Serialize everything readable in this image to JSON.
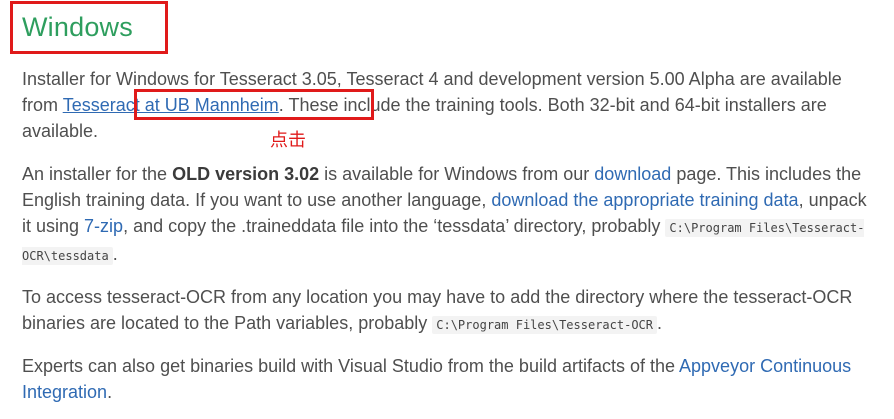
{
  "section": {
    "heading": "Windows"
  },
  "annotation": {
    "click_label": "点击"
  },
  "paragraph1": {
    "text_a": "Installer for Windows for Tesseract 3.05, Tesseract 4 and development version 5.00 Alpha are available from ",
    "link_mannheim": "Tesseract at UB Mannheim",
    "text_b": ". These include the training tools. Both 32-bit and 64-bit installers are available."
  },
  "paragraph2": {
    "text_a": "An installer for the ",
    "bold_version": "OLD version 3.02",
    "text_b": " is available for Windows from our ",
    "link_download": "download",
    "text_c": " page. This includes the English training data. If you want to use another language, ",
    "link_training_data": "download the appropriate training data",
    "text_d": ", unpack it using ",
    "link_7zip": "7-zip",
    "text_e": ", and copy the .traineddata file into the ‘tessdata’ directory, probably ",
    "code_path": "C:\\Program Files\\Tesseract-OCR\\tessdata",
    "text_f": "."
  },
  "paragraph3": {
    "text_a": "To access tesseract-OCR from any location you may have to add the directory where the tesseract-OCR binaries are located to the Path variables, probably ",
    "code_path": "C:\\Program Files\\Tesseract-OCR",
    "text_b": "."
  },
  "paragraph4": {
    "text_a": "Experts can also get binaries build with Visual Studio from the build artifacts of the ",
    "link_appveyor": "Appveyor Continuous Integration",
    "text_b": "."
  },
  "colors": {
    "heading": "#2e9e5e",
    "link": "#2f6ab3",
    "body_text": "#4f4f4f",
    "annotation_red": "#e01a1a"
  }
}
